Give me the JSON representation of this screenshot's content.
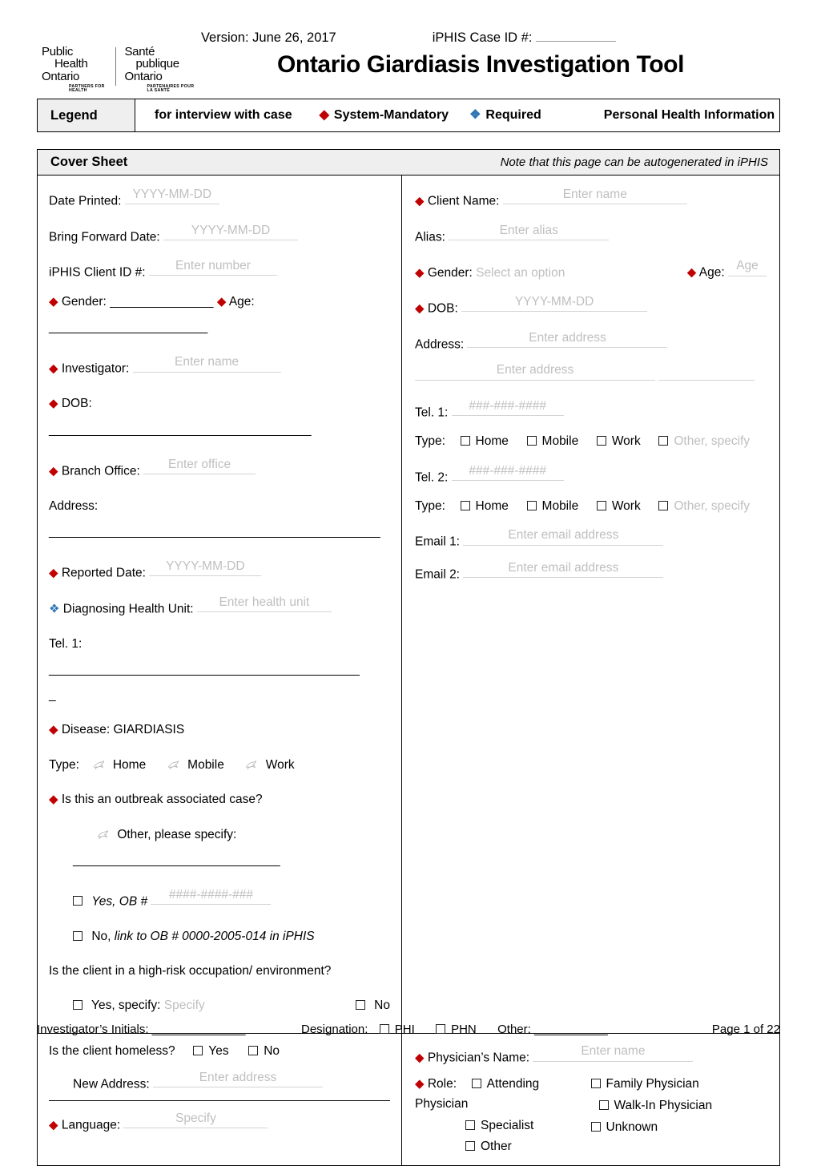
{
  "header": {
    "version": "Version: June 26, 2017",
    "case_id_label": "iPHIS Case ID #:",
    "title": "Ontario Giardiasis Investigation Tool",
    "logo": {
      "en_line1": "Public",
      "en_line2": "Health",
      "en_line3": "Ontario",
      "en_tagline": "PARTNERS FOR HEALTH",
      "fr_line1": "Santé",
      "fr_line2": "publique",
      "fr_line3": "Ontario",
      "fr_tagline": "PARTENAIRES POUR LA SANTÉ"
    }
  },
  "legend": {
    "label": "Legend",
    "interview": "for interview with case",
    "system_mandatory": "System-Mandatory",
    "required": "Required",
    "phi": "Personal Health Information",
    "red_hex": "#C00000",
    "blue_hex": "#2E74B5"
  },
  "cover_sheet": {
    "title": "Cover Sheet",
    "note": "Note that this page can be autogenerated in iPHIS"
  },
  "left": {
    "date_printed_label": "Date Printed:",
    "date_printed_value": "YYYY-MM-DD",
    "bring_forward_label": "Bring Forward Date:",
    "bring_forward_value": "YYYY-MM-DD",
    "client_id_label": "iPHIS Client ID #:",
    "client_id_value": "Enter number",
    "gender_label": "Gender:",
    "gender_blank": "_______________",
    "age_label": "Age:",
    "age_blank": "_______________________",
    "investigator_label": "Investigator:",
    "investigator_value": "Enter name",
    "dob_label": "DOB:",
    "dob_blank": "______________________________________",
    "branch_office_label": "Branch Office:",
    "branch_office_value": "Enter office",
    "address_label": "Address:",
    "address_blank": "________________________________________________",
    "reported_date_label": "Reported Date:",
    "reported_date_value": "YYYY-MM-DD",
    "health_unit_label": "Diagnosing Health Unit:",
    "health_unit_value": "Enter health unit",
    "tel1_label": "Tel. 1:",
    "tel1_blank": "_____________________________________________",
    "tel1_blank2": "_",
    "disease_label": "Disease: GIARDIASIS",
    "type_label": "Type:",
    "type_home": "Home",
    "type_mobile": "Mobile",
    "type_work": "Work",
    "outbreak_question": "Is this an outbreak associated case?",
    "other_specify": "Other, please specify:",
    "other_specify_blank": "______________________________",
    "yes_ob_label": "Yes, OB #",
    "yes_ob_value": "####-####-###",
    "no_link_label": "No,",
    "no_link_italic": "link to OB # 0000-2005-014 in iPHIS",
    "highrisk_question": "Is the client in a high-risk occupation/ environment?",
    "yes_specify_label": "Yes, specify:",
    "yes_specify_value": "Specify",
    "no_label": "No"
  },
  "right": {
    "client_name_label": "Client Name:",
    "client_name_value": "Enter name",
    "alias_label": "Alias:",
    "alias_value": "Enter alias",
    "gender_label": "Gender:",
    "gender_value": "Select an option",
    "age_label": "Age:",
    "age_value": "Age",
    "dob_label": "DOB:",
    "dob_value": "YYYY-MM-DD",
    "address_label": "Address:",
    "address_value": "Enter address",
    "address_value2": "Enter address",
    "tel1_label": "Tel. 1:",
    "tel1_value": "###-###-####",
    "type_label": "Type:",
    "type_home": "Home",
    "type_mobile": "Mobile",
    "type_work": "Work",
    "type_other": "Other, specify",
    "tel2_label": "Tel. 2:",
    "tel2_value": "###-###-####",
    "email1_label": "Email 1:",
    "email1_value": "Enter email address",
    "email2_label": "Email 2:",
    "email2_value": "Enter email address"
  },
  "bottom_left": {
    "homeless_question": "Is the client homeless?",
    "yes_label": "Yes",
    "no_label": "No",
    "new_address_label": "New Address:",
    "new_address_value": "Enter address",
    "language_label": "Language:",
    "language_value": "Specify"
  },
  "bottom_right": {
    "physician_name_label": "Physician’s Name:",
    "physician_name_value": "Enter name",
    "role_label": "Role:",
    "role_attending": "Attending Physician",
    "role_family": "Family Physician",
    "role_specialist": "Specialist",
    "role_walkin": "Walk-In Physician",
    "role_other": "Other",
    "role_unknown": "Unknown"
  },
  "footer": {
    "initials_label": "Investigator’s Initials:",
    "initials_blank": "______________",
    "designation_label": "Designation:",
    "phi_label": "PHI",
    "phn_label": "PHN",
    "other_label": "Other:",
    "other_blank": "___________",
    "page_label": "Page 1 of 22"
  }
}
